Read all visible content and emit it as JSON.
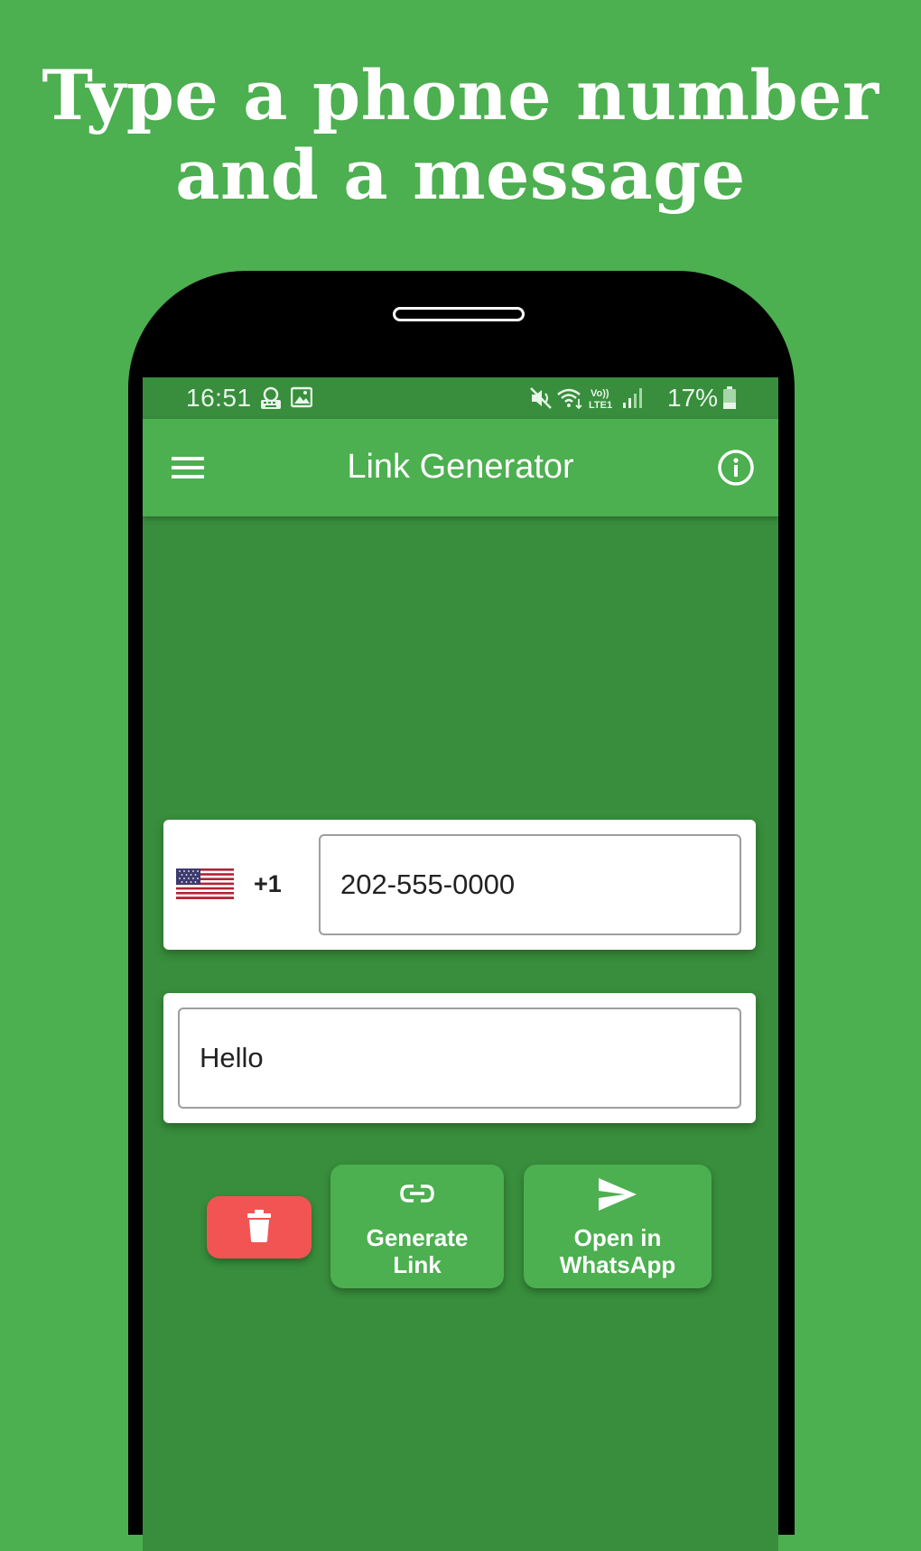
{
  "headline": "Type a phone number\nand a message",
  "status_bar": {
    "time": "16:51",
    "battery": "17%",
    "icons": [
      "keyboard-icon",
      "image-icon",
      "mute-icon",
      "wifi-icon",
      "volte-icon",
      "signal-icon",
      "battery-icon"
    ]
  },
  "app_bar": {
    "title": "Link Generator",
    "menu_icon": "hamburger-icon",
    "info_icon": "info-icon"
  },
  "phone_input": {
    "country_flag": "us-flag-icon",
    "country_code": "+1",
    "value": "202-555-0000"
  },
  "message_input": {
    "value": "Hello"
  },
  "buttons": {
    "delete_icon": "trash-icon",
    "generate_icon": "link-icon",
    "generate_label": "Generate\nLink",
    "open_icon": "send-icon",
    "open_label": "Open in\nWhatsApp"
  },
  "colors": {
    "background": "#4CAF50",
    "screen": "#388E3C",
    "app_bar": "#4CAF50",
    "delete_button": "#F25454",
    "action_button": "#4CAF50"
  }
}
